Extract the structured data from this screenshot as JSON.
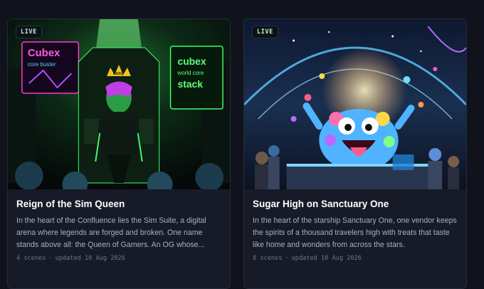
{
  "cards": [
    {
      "badge": "LIVE",
      "title": "Reign of the Sim Queen",
      "description": "In the heart of the Confluence lies the Sim Suite, a digital arena where legends are forged and broken. One name stands above all: the Queen of Gamers. An OG whose...",
      "meta_scenes": "4 scenes",
      "meta_updated": "updated 10 Aug 2026",
      "art": {
        "sign_left_line1": "Cubex",
        "sign_left_line2": "core buster",
        "sign_right_line1": "cubex",
        "sign_right_line2": "world core",
        "sign_right_line3": "stack",
        "crown_text": "NASQ"
      }
    },
    {
      "badge": "LIVE",
      "title": "Sugar High on Sanctuary One",
      "description": "In the heart of the starship Sanctuary One, one vendor keeps the spirits of a thousand travelers high with treats that taste like home and wonders from across the stars.",
      "meta_scenes": "8 scenes",
      "meta_updated": "updated 10 Aug 2026"
    }
  ],
  "meta_separator": "·",
  "colors": {
    "background": "#10131c",
    "card": "#161b27",
    "badge_text": "#b8f5c8",
    "neon_green": "#39ff6a",
    "neon_pink": "#ff3ad0"
  }
}
